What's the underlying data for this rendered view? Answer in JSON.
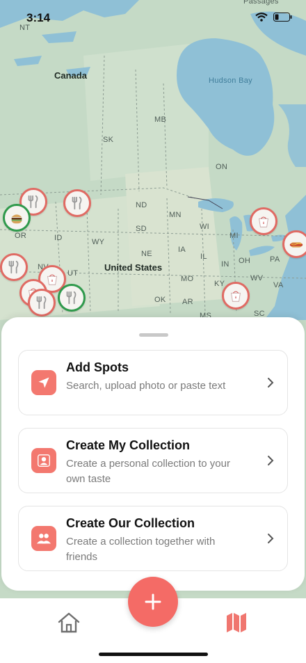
{
  "status": {
    "time": "3:14"
  },
  "map": {
    "labels": {
      "canada": "Canada",
      "hudson_bay": "Hudson Bay",
      "us": "United States",
      "nt": "NT",
      "mb": "MB",
      "sk": "SK",
      "on": "ON",
      "nd": "ND",
      "mn": "MN",
      "sd": "SD",
      "wi": "WI",
      "mi": "MI",
      "ne": "NE",
      "ia": "IA",
      "il": "IL",
      "in": "IN",
      "oh": "OH",
      "pa": "PA",
      "wy": "WY",
      "id": "ID",
      "or": "OR",
      "nv": "NV",
      "ut": "UT",
      "mo": "MO",
      "ky": "KY",
      "wv": "WV",
      "va": "VA",
      "ok": "OK",
      "ar": "AR",
      "ms": "MS",
      "sc": "SC",
      "passages": "Passages"
    },
    "pin_icons": [
      "fork-knife-icon",
      "burger-icon",
      "takeout-box-icon",
      "hotdog-icon"
    ]
  },
  "sheet": {
    "items": [
      {
        "title": "Add Spots",
        "desc": "Search, upload photo or paste text",
        "icon": "location-arrow-icon"
      },
      {
        "title": "Create My Collection",
        "desc": "Create a personal collection to your own taste",
        "icon": "person-icon"
      },
      {
        "title": "Create Our Collection",
        "desc": "Create a collection together with friends",
        "icon": "people-icon"
      }
    ]
  },
  "tabbar": {
    "tabs": [
      "home-icon",
      "map-icon"
    ],
    "fab_icon": "plus-icon"
  },
  "colors": {
    "accent": "#f46b66",
    "pin_red": "#e06a63",
    "pin_green": "#2f9a4c",
    "water": "#8fc0d6",
    "land": "#c9dcc9"
  }
}
